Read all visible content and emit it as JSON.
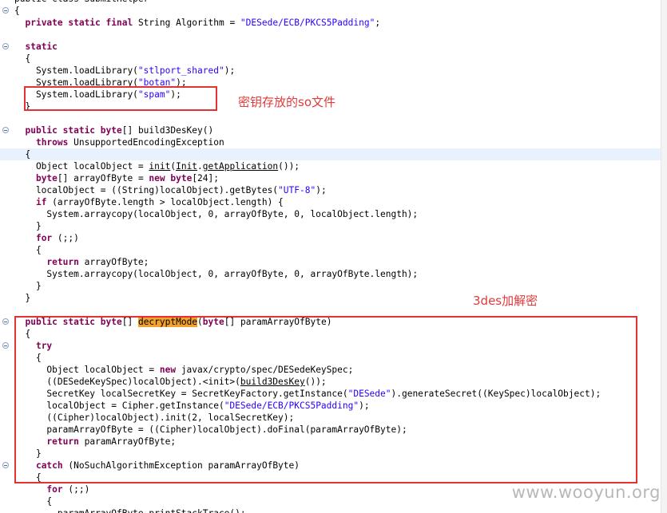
{
  "code_lines": [
    [
      {
        "t": "public class SubmitHelper",
        "c": ""
      }
    ],
    [
      {
        "t": "{",
        "c": ""
      }
    ],
    [
      {
        "t": "  ",
        "c": ""
      },
      {
        "t": "private static final",
        "c": "kw"
      },
      {
        "t": " String Algorithm = ",
        "c": ""
      },
      {
        "t": "\"DESede/ECB/PKCS5Padding\"",
        "c": "str"
      },
      {
        "t": ";",
        "c": ""
      }
    ],
    [],
    [
      {
        "t": "  ",
        "c": ""
      },
      {
        "t": "static",
        "c": "kw"
      }
    ],
    [
      {
        "t": "  {",
        "c": ""
      }
    ],
    [
      {
        "t": "    System.loadLibrary(",
        "c": ""
      },
      {
        "t": "\"stlport_shared\"",
        "c": "str"
      },
      {
        "t": ");",
        "c": ""
      }
    ],
    [
      {
        "t": "    System.loadLibrary(",
        "c": ""
      },
      {
        "t": "\"botan\"",
        "c": "str"
      },
      {
        "t": ");",
        "c": ""
      }
    ],
    [
      {
        "t": "    System.loadLibrary(",
        "c": ""
      },
      {
        "t": "\"spam\"",
        "c": "str"
      },
      {
        "t": ");",
        "c": ""
      }
    ],
    [
      {
        "t": "  }",
        "c": ""
      }
    ],
    [],
    [
      {
        "t": "  ",
        "c": ""
      },
      {
        "t": "public static byte",
        "c": "kw"
      },
      {
        "t": "[] build3DesKey()",
        "c": ""
      }
    ],
    [
      {
        "t": "    ",
        "c": ""
      },
      {
        "t": "throws",
        "c": "kw"
      },
      {
        "t": " UnsupportedEncodingException",
        "c": ""
      }
    ],
    [
      {
        "t": "  {",
        "c": ""
      }
    ],
    [
      {
        "t": "    Object localObject = ",
        "c": ""
      },
      {
        "t": "init",
        "c": "ul"
      },
      {
        "t": "(",
        "c": ""
      },
      {
        "t": "Init",
        "c": "ul"
      },
      {
        "t": ".",
        "c": ""
      },
      {
        "t": "getApplication",
        "c": "ul"
      },
      {
        "t": "());",
        "c": ""
      }
    ],
    [
      {
        "t": "    ",
        "c": ""
      },
      {
        "t": "byte",
        "c": "kw"
      },
      {
        "t": "[] arrayOfByte = ",
        "c": ""
      },
      {
        "t": "new byte",
        "c": "kw"
      },
      {
        "t": "[24];",
        "c": ""
      }
    ],
    [
      {
        "t": "    localObject = ((String)localObject).getBytes(",
        "c": ""
      },
      {
        "t": "\"UTF-8\"",
        "c": "str"
      },
      {
        "t": ");",
        "c": ""
      }
    ],
    [
      {
        "t": "    ",
        "c": ""
      },
      {
        "t": "if",
        "c": "kw"
      },
      {
        "t": " (arrayOfByte.length > localObject.length) {",
        "c": ""
      }
    ],
    [
      {
        "t": "      System.arraycopy(localObject, 0, arrayOfByte, 0, localObject.length);",
        "c": ""
      }
    ],
    [
      {
        "t": "    }",
        "c": ""
      }
    ],
    [
      {
        "t": "    ",
        "c": ""
      },
      {
        "t": "for",
        "c": "kw"
      },
      {
        "t": " (;;)",
        "c": ""
      }
    ],
    [
      {
        "t": "    {",
        "c": ""
      }
    ],
    [
      {
        "t": "      ",
        "c": ""
      },
      {
        "t": "return",
        "c": "kw"
      },
      {
        "t": " arrayOfByte;",
        "c": ""
      }
    ],
    [
      {
        "t": "      System.arraycopy(localObject, 0, arrayOfByte, 0, arrayOfByte.length);",
        "c": ""
      }
    ],
    [
      {
        "t": "    }",
        "c": ""
      }
    ],
    [
      {
        "t": "  }",
        "c": ""
      }
    ],
    [],
    [
      {
        "t": "  ",
        "c": ""
      },
      {
        "t": "public static byte",
        "c": "kw"
      },
      {
        "t": "[] ",
        "c": ""
      },
      {
        "t": "decryptMode",
        "c": "mark"
      },
      {
        "t": "(",
        "c": ""
      },
      {
        "t": "byte",
        "c": "kw"
      },
      {
        "t": "[] paramArrayOfByte)",
        "c": ""
      }
    ],
    [
      {
        "t": "  {",
        "c": ""
      }
    ],
    [
      {
        "t": "    ",
        "c": ""
      },
      {
        "t": "try",
        "c": "kw"
      }
    ],
    [
      {
        "t": "    {",
        "c": ""
      }
    ],
    [
      {
        "t": "      Object localObject = ",
        "c": ""
      },
      {
        "t": "new",
        "c": "kw"
      },
      {
        "t": " javax/crypto/spec/DESedeKeySpec;",
        "c": ""
      }
    ],
    [
      {
        "t": "      ((DESedeKeySpec)localObject).<init>(",
        "c": ""
      },
      {
        "t": "build3DesKey",
        "c": "ul"
      },
      {
        "t": "());",
        "c": ""
      }
    ],
    [
      {
        "t": "      SecretKey localSecretKey = SecretKeyFactory.getInstance(",
        "c": ""
      },
      {
        "t": "\"DESede\"",
        "c": "str"
      },
      {
        "t": ").generateSecret((KeySpec)localObject);",
        "c": ""
      }
    ],
    [
      {
        "t": "      localObject = Cipher.getInstance(",
        "c": ""
      },
      {
        "t": "\"DESede/ECB/PKCS5Padding\"",
        "c": "str"
      },
      {
        "t": ");",
        "c": ""
      }
    ],
    [
      {
        "t": "      ((Cipher)localObject).init(2, localSecretKey);",
        "c": ""
      }
    ],
    [
      {
        "t": "      paramArrayOfByte = ((Cipher)localObject).doFinal(paramArrayOfByte);",
        "c": ""
      }
    ],
    [
      {
        "t": "      ",
        "c": ""
      },
      {
        "t": "return",
        "c": "kw"
      },
      {
        "t": " paramArrayOfByte;",
        "c": ""
      }
    ],
    [
      {
        "t": "    }",
        "c": ""
      }
    ],
    [
      {
        "t": "    ",
        "c": ""
      },
      {
        "t": "catch",
        "c": "kw"
      },
      {
        "t": " (NoSuchAlgorithmException paramArrayOfByte)",
        "c": ""
      }
    ],
    [
      {
        "t": "    {",
        "c": ""
      }
    ],
    [
      {
        "t": "      ",
        "c": ""
      },
      {
        "t": "for",
        "c": "kw"
      },
      {
        "t": " (;;)",
        "c": ""
      }
    ],
    [
      {
        "t": "      {",
        "c": ""
      }
    ],
    [
      {
        "t": "        paramArrayOfByte.printStackTrace();",
        "c": ""
      }
    ]
  ],
  "fold_markers": [
    1,
    4,
    11,
    27,
    29,
    39
  ],
  "highlighted_lines": [
    13
  ],
  "annotations": {
    "so_file_label": "密钥存放的so文件",
    "decrypt_label": "3des加解密"
  },
  "watermark": "www.wooyun.org",
  "colors": {
    "keyword": "#7f0055",
    "string": "#2a00ff",
    "annotation_red": "#e23232",
    "search_highlight": "#f3a22b",
    "current_line": "#e8f2fe"
  }
}
